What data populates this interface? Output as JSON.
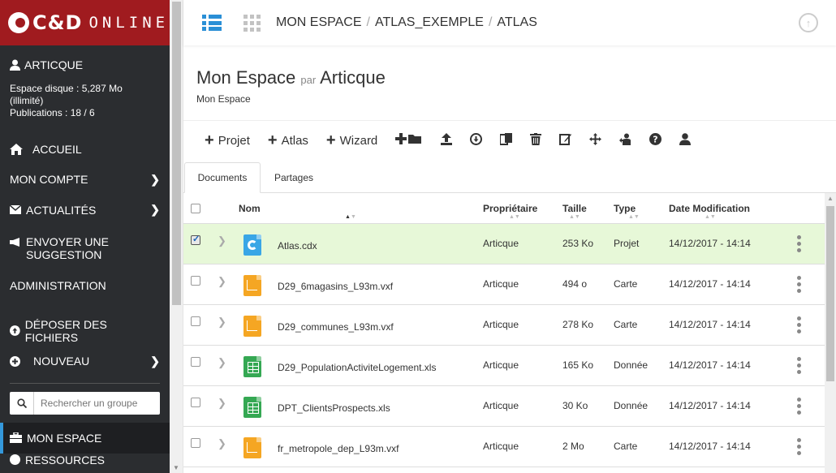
{
  "brand": {
    "cd": "C&D",
    "online": "ONLINE"
  },
  "user": {
    "name": "ARTICQUE",
    "disk": "Espace disque : 5,287 Mo",
    "disk_limit": "(illimité)",
    "publications": "Publications : 18 / 6"
  },
  "nav": {
    "accueil": "ACCUEIL",
    "mon_compte": "MON COMPTE",
    "actualites": "ACTUALITÉS",
    "suggestion_l1": "ENVOYER UNE",
    "suggestion_l2": "SUGGESTION",
    "administration": "ADMINISTRATION",
    "deposer": "DÉPOSER DES FICHIERS",
    "nouveau": "NOUVEAU",
    "search_placeholder": "Rechercher un groupe",
    "mon_espace": "MON ESPACE",
    "ressources": "RESSOURCES"
  },
  "breadcrumb": {
    "item1": "MON ESPACE",
    "item2": "ATLAS_EXEMPLE",
    "item3": "ATLAS",
    "sep": "/"
  },
  "page": {
    "title": "Mon Espace",
    "par": "par",
    "owner": "Articque",
    "subtitle": "Mon Espace"
  },
  "toolbar": {
    "projet": "Projet",
    "atlas": "Atlas",
    "wizard": "Wizard"
  },
  "tabs": {
    "documents": "Documents",
    "partages": "Partages"
  },
  "table": {
    "headers": {
      "nom": "Nom",
      "proprietaire": "Propriétaire",
      "taille": "Taille",
      "type": "Type",
      "date": "Date Modification"
    },
    "rows": [
      {
        "name": "Atlas.cdx",
        "owner": "Articque",
        "size": "253 Ko",
        "type": "Projet",
        "date": "14/12/2017 - 14:14"
      },
      {
        "name": "D29_6magasins_L93m.vxf",
        "owner": "Articque",
        "size": "494 o",
        "type": "Carte",
        "date": "14/12/2017 - 14:14"
      },
      {
        "name": "D29_communes_L93m.vxf",
        "owner": "Articque",
        "size": "278 Ko",
        "type": "Carte",
        "date": "14/12/2017 - 14:14"
      },
      {
        "name": "D29_PopulationActiviteLogement.xls",
        "owner": "Articque",
        "size": "165 Ko",
        "type": "Donnée",
        "date": "14/12/2017 - 14:14"
      },
      {
        "name": "DPT_ClientsProspects.xls",
        "owner": "Articque",
        "size": "30 Ko",
        "type": "Donnée",
        "date": "14/12/2017 - 14:14"
      },
      {
        "name": "fr_metropole_dep_L93m.vxf",
        "owner": "Articque",
        "size": "2 Mo",
        "type": "Carte",
        "date": "14/12/2017 - 14:14"
      }
    ]
  }
}
